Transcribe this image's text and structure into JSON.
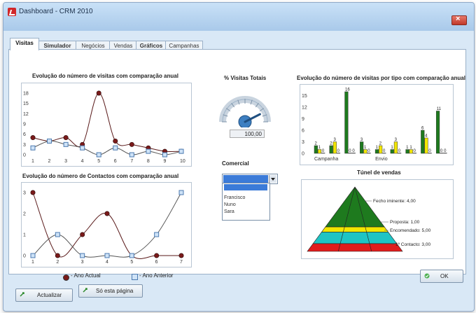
{
  "window": {
    "title": "Dashboard - CRM 2010"
  },
  "tabs": [
    {
      "label": "Visitas",
      "active": true
    },
    {
      "label": "Simulador",
      "active": false
    },
    {
      "label": "Negócios",
      "active": false
    },
    {
      "label": "Vendas",
      "active": false
    },
    {
      "label": "Gráficos",
      "active": false
    },
    {
      "label": "Campanhas",
      "active": false
    }
  ],
  "chart_titles": {
    "visits": "Evolução do número de visitas com comparação anual",
    "contacts": "Evolução do número de Contactos com comparação anual",
    "gauge": "% Visitas Totais",
    "by_type": "Evolução do número de visitas por tipo com comparação anual",
    "funnel": "Túnel de vendas"
  },
  "gauge": {
    "value_label": "100,00",
    "value": 100
  },
  "commercial": {
    "label": "Comercial",
    "options": [
      "Francisco",
      "Nuno",
      "Sara"
    ]
  },
  "legend": {
    "actual": "- Ano Actual",
    "anterior": "- Ano Anterior"
  },
  "buttons": {
    "refresh": "Actualizar",
    "this_page": "Só esta página",
    "ok": "OK"
  },
  "colors": {
    "actual": "#7a1a1a",
    "anterior": "#4b7ab0",
    "bar_dark": "#1e7a1e",
    "bar_yellow": "#f2e600"
  },
  "chart_data": [
    {
      "type": "line",
      "title": "Evolução do número de visitas com comparação anual",
      "x": [
        1,
        2,
        3,
        4,
        5,
        6,
        7,
        8,
        9,
        10
      ],
      "ylim": [
        0,
        18
      ],
      "yticks": [
        0,
        3,
        6,
        9,
        12,
        15,
        18
      ],
      "series": [
        {
          "name": "Ano Actual",
          "values": [
            5,
            4,
            5,
            3,
            18,
            4,
            3,
            2,
            1,
            1
          ]
        },
        {
          "name": "Ano Anterior",
          "values": [
            2,
            4,
            3,
            2,
            0,
            2,
            0,
            1,
            0,
            1
          ]
        }
      ]
    },
    {
      "type": "line",
      "title": "Evolução do número de Contactos com comparação anual",
      "x": [
        1,
        2,
        3,
        4,
        5,
        6,
        7
      ],
      "ylim": [
        0,
        3
      ],
      "yticks": [
        0,
        1,
        2,
        3
      ],
      "series": [
        {
          "name": "Ano Actual",
          "values": [
            3,
            0,
            1,
            2,
            0,
            0,
            0
          ]
        },
        {
          "name": "Ano Anterior",
          "values": [
            0,
            1,
            0,
            0,
            0,
            1,
            3
          ]
        }
      ]
    },
    {
      "type": "bar",
      "title": "Evolução do número de visitas por tipo com comparação anual",
      "categories": [
        "Campanha",
        "",
        "",
        "",
        "Envio",
        "",
        "",
        "",
        ""
      ],
      "ylim": [
        0,
        16
      ],
      "yticks": [
        0,
        3,
        6,
        9,
        12,
        15
      ],
      "series": [
        {
          "name": "dark",
          "values": [
            2,
            2,
            16,
            3,
            1,
            1,
            1,
            6,
            11
          ]
        },
        {
          "name": "yellow",
          "values": [
            1,
            3,
            0,
            1,
            2,
            3,
            1,
            4,
            0
          ]
        },
        {
          "name": "white",
          "values": [
            0,
            0,
            0,
            0,
            0,
            0,
            0,
            0,
            0
          ]
        }
      ]
    },
    {
      "type": "funnel",
      "title": "Túnel de vendas",
      "stages": [
        {
          "label": "Fecho iminente: 4,00",
          "value": 4
        },
        {
          "label": "Proposta: 1,00",
          "value": 1
        },
        {
          "label": "Encomendado: 5,00",
          "value": 5
        },
        {
          "label": "1º Contacto: 3,00",
          "value": 3
        }
      ]
    }
  ]
}
